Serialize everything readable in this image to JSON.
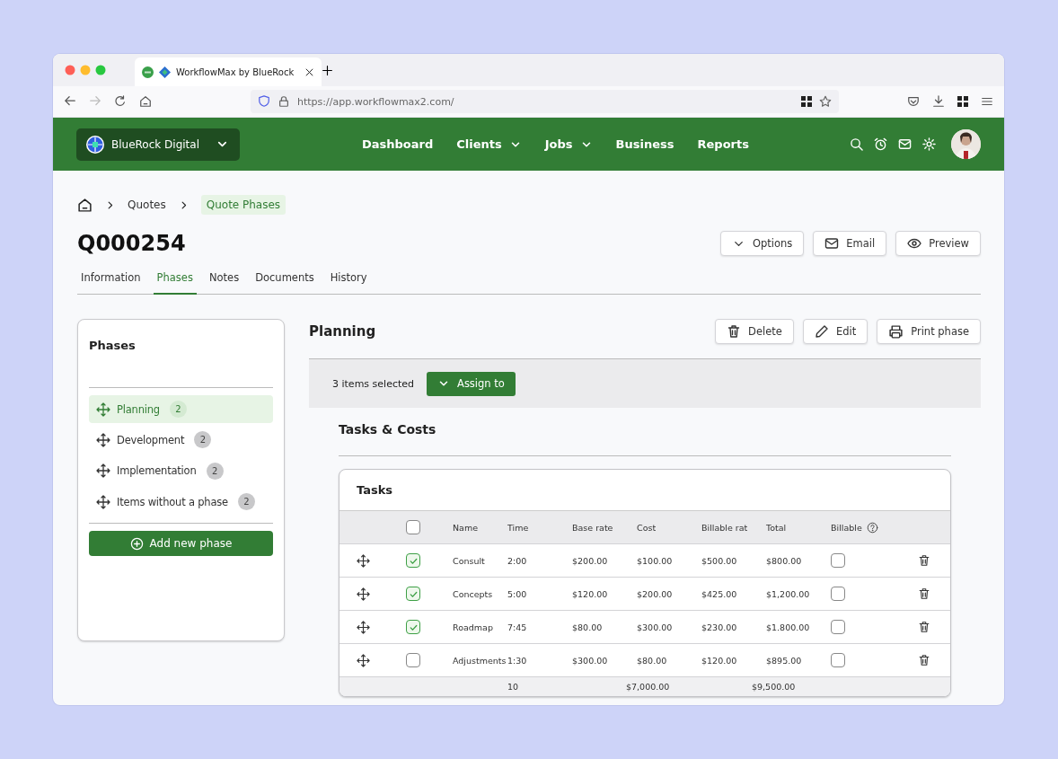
{
  "browser": {
    "tab_title": "WorkflowMax by BlueRock",
    "url": "https://app.workflowmax2.com/"
  },
  "nav": {
    "organization": "BlueRock Digital",
    "items": [
      {
        "label": "Dashboard",
        "has_menu": false
      },
      {
        "label": "Clients",
        "has_menu": true
      },
      {
        "label": "Jobs",
        "has_menu": true
      },
      {
        "label": "Business",
        "has_menu": false
      },
      {
        "label": "Reports",
        "has_menu": false
      }
    ]
  },
  "breadcrumb": [
    "Quotes",
    "Quote Phases"
  ],
  "title": "Q000254",
  "actions": [
    {
      "kind": "options",
      "label": "Options"
    },
    {
      "kind": "email",
      "label": "Email"
    },
    {
      "kind": "preview",
      "label": "Preview"
    }
  ],
  "tabs": [
    {
      "label": "Information",
      "selected": false
    },
    {
      "label": "Phases",
      "selected": true
    },
    {
      "label": "Notes",
      "selected": false
    },
    {
      "label": "Documents",
      "selected": false
    },
    {
      "label": "History",
      "selected": false
    }
  ],
  "phases_panel": {
    "title": "Phases",
    "items": [
      {
        "label": "Planning",
        "count": "2",
        "selected": true
      },
      {
        "label": "Development",
        "count": "2",
        "selected": false
      },
      {
        "label": "Implementation",
        "count": "2",
        "selected": false
      },
      {
        "label": "Items without a phase",
        "count": "2",
        "selected": false
      }
    ],
    "add_button": "Add new phase"
  },
  "phase": {
    "title": "Planning",
    "actions": [
      {
        "kind": "delete",
        "label": "Delete"
      },
      {
        "kind": "edit",
        "label": "Edit"
      },
      {
        "kind": "print",
        "label": "Print phase"
      }
    ],
    "selection": {
      "text": "3 items selected",
      "button": "Assign to"
    },
    "section_title": "Tasks & Costs",
    "tasks": {
      "title": "Tasks",
      "select_all": false,
      "columns": [
        "Name",
        "Time",
        "Base rate",
        "Cost",
        "Billable rat",
        "Total",
        "Billable"
      ],
      "rows": [
        {
          "name": "Consult",
          "time": "2:00",
          "base_rate": "$200.00",
          "cost": "$100.00",
          "billable_rate": "$500.00",
          "total": "$800.00",
          "checked": true,
          "billable": false
        },
        {
          "name": "Concepts",
          "time": "5:00",
          "base_rate": "$120.00",
          "cost": "$200.00",
          "billable_rate": "$425.00",
          "total": "$1,200.00",
          "checked": true,
          "billable": false
        },
        {
          "name": "Roadmap",
          "time": "7:45",
          "base_rate": "$80.00",
          "cost": "$300.00",
          "billable_rate": "$230.00",
          "total": "$1.800.00",
          "checked": true,
          "billable": false
        },
        {
          "name": "Adjustments",
          "time": "1:30",
          "base_rate": "$300.00",
          "cost": "$80.00",
          "billable_rate": "$120.00",
          "total": "$895.00",
          "checked": false,
          "billable": false
        }
      ],
      "totals": {
        "time": "10",
        "cost": "$7,000.00",
        "total": "$9,500.00"
      }
    }
  }
}
